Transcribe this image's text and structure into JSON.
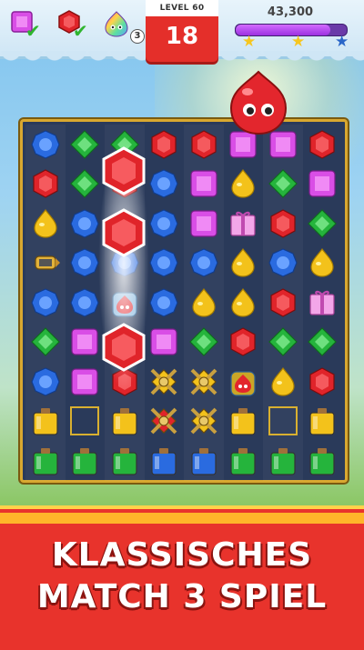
{
  "header": {
    "goals": [
      {
        "icon": "pink-square-gem-icon",
        "status": "complete"
      },
      {
        "icon": "red-hexagon-gem-icon",
        "status": "complete"
      },
      {
        "icon": "rainbow-jelly-icon",
        "count": "3"
      }
    ],
    "level_label": "LEVEL 60",
    "moves_left": "18",
    "score": "43,300",
    "progress_fraction": 0.85,
    "stars": [
      "star-icon",
      "star-icon",
      "star-icon"
    ]
  },
  "board": {
    "rows": [
      [
        "blue",
        "green",
        "green",
        "red",
        "red",
        "pink",
        "pink",
        "red"
      ],
      [
        "red",
        "green",
        "red",
        "blue",
        "pink",
        "yellow",
        "green",
        "pink"
      ],
      [
        "yellow",
        "blue",
        "red",
        "blue",
        "pink",
        "gift",
        "red",
        "green"
      ],
      [
        "rocket",
        "blue",
        "blue",
        "blue",
        "blue",
        "yellow",
        "blue",
        "yellow"
      ],
      [
        "blue",
        "blue",
        "jelly",
        "blue",
        "yellow",
        "yellow",
        "red",
        "gift"
      ],
      [
        "green",
        "pink",
        "blue",
        "pink",
        "green",
        "red",
        "green",
        "green"
      ],
      [
        "blue",
        "pink",
        "red",
        "chain",
        "chain",
        "jellyjar",
        "yellow",
        "red"
      ],
      [
        "jar-yellow",
        "empty",
        "jar-yellow",
        "chain-red",
        "chain",
        "jar-yellow",
        "empty",
        "jar-yellow"
      ],
      [
        "jar-green",
        "jar-green",
        "jar-green",
        "jar-blue",
        "jar-blue",
        "jar-green",
        "jar-green",
        "jar-green"
      ]
    ],
    "colors": {
      "red": "#e0242a",
      "blue": "#2a6be0",
      "green": "#25b43c",
      "yellow": "#f3c21b",
      "pink": "#d94ee6"
    }
  },
  "banner": {
    "line1": "KLASSISCHES",
    "line2": "MATCH 3 SPIEL"
  }
}
